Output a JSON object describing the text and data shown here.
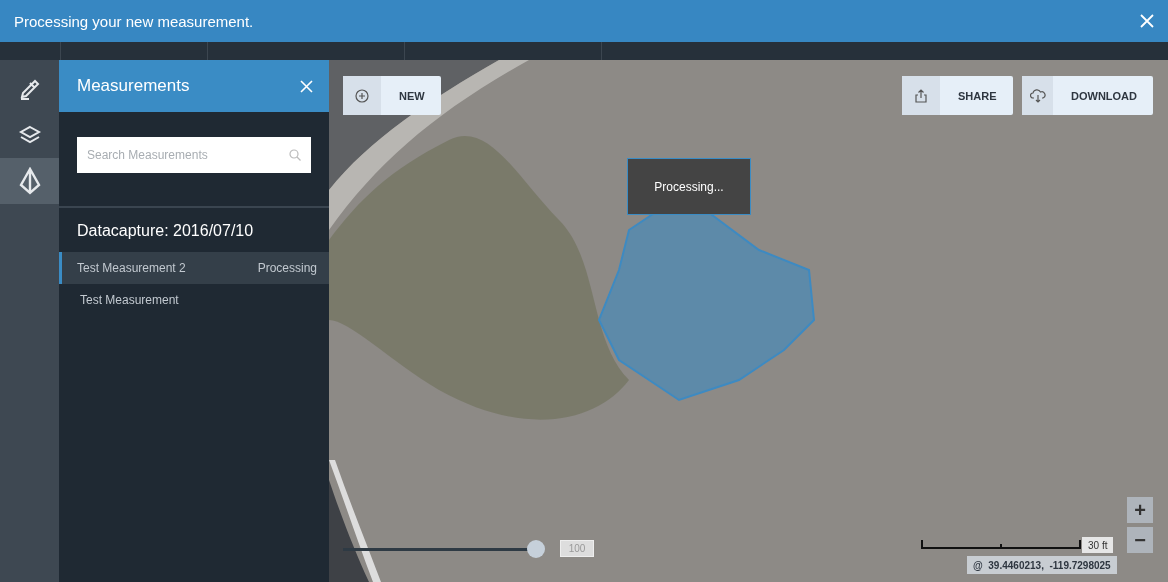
{
  "banner": {
    "message": "Processing your new measurement."
  },
  "rail": [
    {
      "kind": "annotate",
      "selected": false
    },
    {
      "kind": "layers",
      "selected": false
    },
    {
      "kind": "measure",
      "selected": true
    }
  ],
  "panel": {
    "title": "Measurements",
    "search": {
      "placeholder": "Search Measurements"
    },
    "group": "Datacapture: 2016/07/10",
    "items": [
      {
        "name": "Test Measurement 2",
        "status": "Processing",
        "selected": true
      },
      {
        "name": "Test Measurement",
        "selected": false
      }
    ]
  },
  "map": {
    "toolbar": [
      {
        "label": "NEW",
        "kind": "new"
      },
      {
        "label": "SHARE",
        "kind": "share"
      },
      {
        "label": "DOWNLOAD",
        "kind": "download"
      }
    ],
    "processing": "Processing...",
    "opacity": {
      "level": 1,
      "reading": "100"
    },
    "zoom": [
      "+",
      "−"
    ],
    "scale": "30 ft",
    "coordinates": "@  39.4460213,  -119.7298025"
  }
}
